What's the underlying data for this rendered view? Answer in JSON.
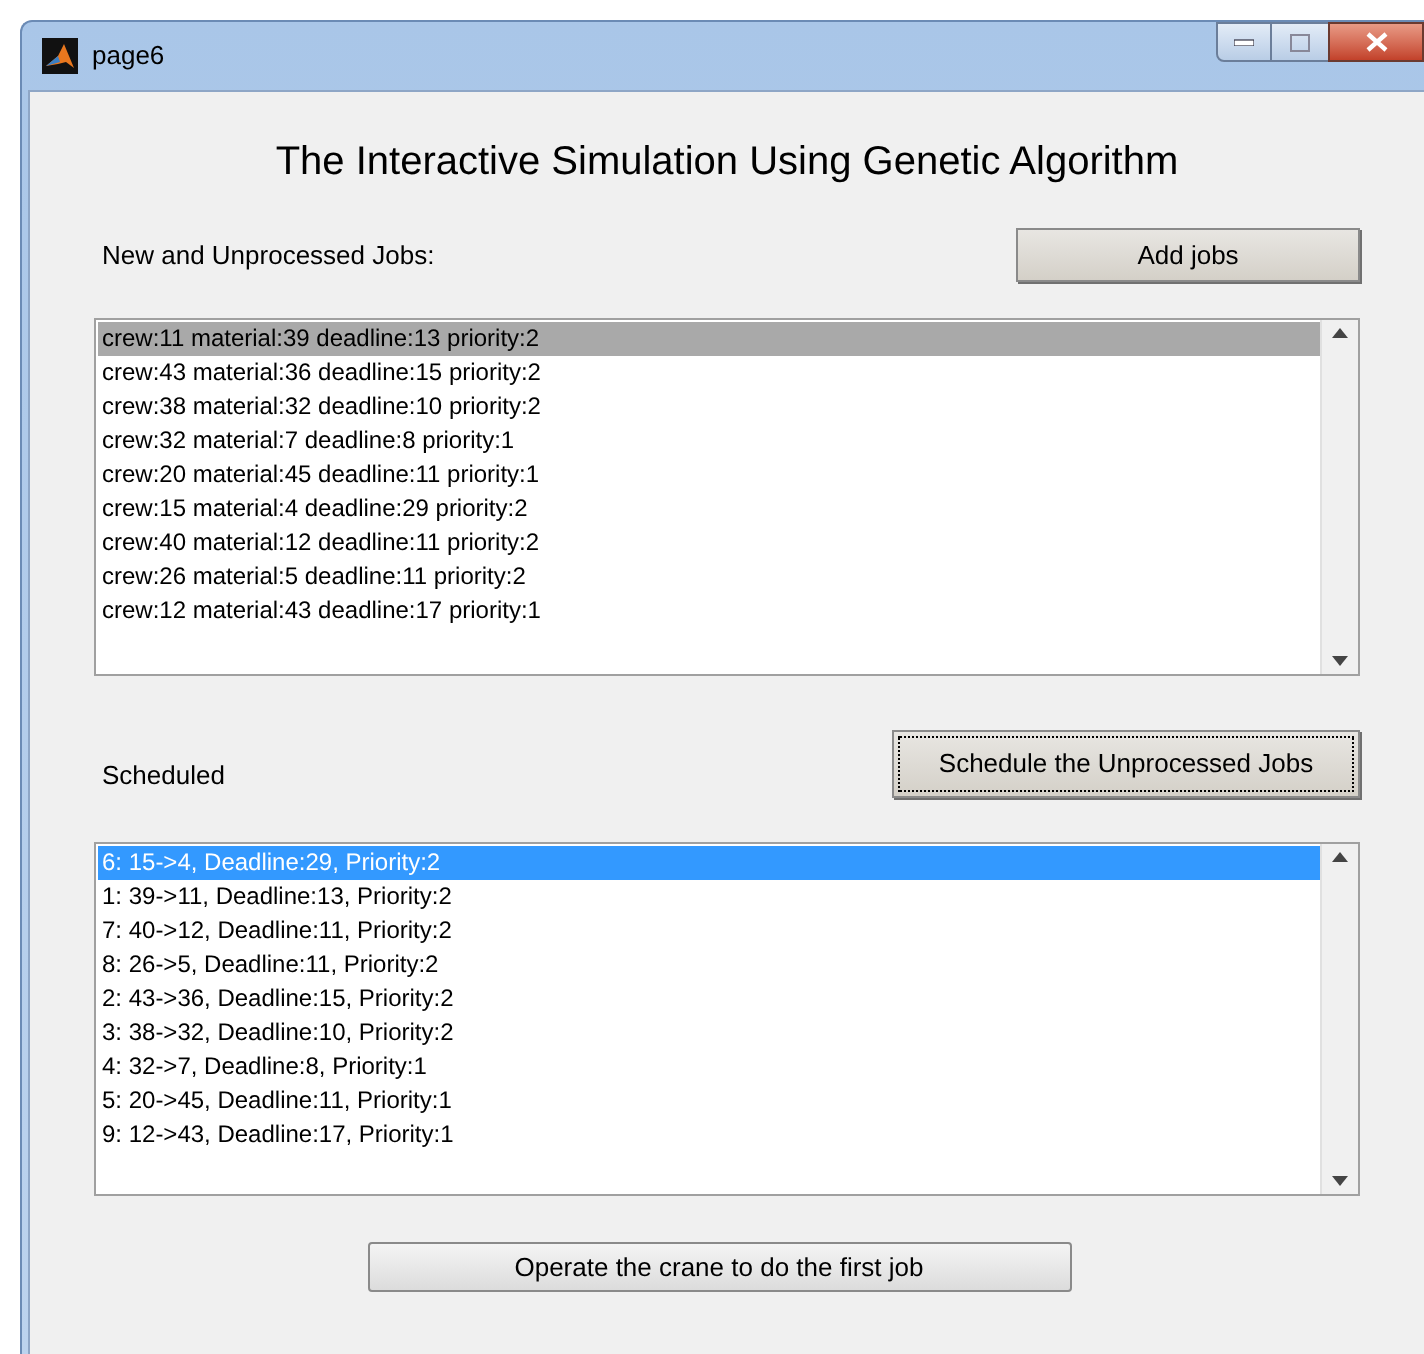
{
  "window": {
    "title": "page6"
  },
  "heading": "The Interactive Simulation Using Genetic Algorithm",
  "sections": [
    {
      "label": "New and Unprocessed Jobs:",
      "button": {
        "label": "Add jobs",
        "focused": false
      },
      "list": {
        "focused": false,
        "items": [
          {
            "text": "crew:11 material:39 deadline:13 priority:2",
            "selected": true
          },
          {
            "text": "crew:43 material:36 deadline:15 priority:2",
            "selected": false
          },
          {
            "text": "crew:38 material:32 deadline:10 priority:2",
            "selected": false
          },
          {
            "text": "crew:32 material:7 deadline:8 priority:1",
            "selected": false
          },
          {
            "text": "crew:20 material:45 deadline:11 priority:1",
            "selected": false
          },
          {
            "text": "crew:15 material:4 deadline:29 priority:2",
            "selected": false
          },
          {
            "text": "crew:40 material:12 deadline:11 priority:2",
            "selected": false
          },
          {
            "text": "crew:26 material:5 deadline:11 priority:2",
            "selected": false
          },
          {
            "text": "crew:12 material:43 deadline:17 priority:1",
            "selected": false
          }
        ]
      }
    },
    {
      "label": "Scheduled",
      "button": {
        "label": "Schedule the Unprocessed Jobs",
        "focused": true
      },
      "list": {
        "focused": true,
        "items": [
          {
            "text": "6: 15->4, Deadline:29, Priority:2",
            "selected": true
          },
          {
            "text": "1: 39->11, Deadline:13, Priority:2",
            "selected": false
          },
          {
            "text": "7: 40->12, Deadline:11, Priority:2",
            "selected": false
          },
          {
            "text": "8: 26->5, Deadline:11, Priority:2",
            "selected": false
          },
          {
            "text": "2: 43->36, Deadline:15, Priority:2",
            "selected": false
          },
          {
            "text": "3: 38->32, Deadline:10, Priority:2",
            "selected": false
          },
          {
            "text": "4: 32->7, Deadline:8, Priority:1",
            "selected": false
          },
          {
            "text": "5: 20->45, Deadline:11, Priority:1",
            "selected": false
          },
          {
            "text": "9: 12->43, Deadline:17, Priority:1",
            "selected": false
          }
        ]
      }
    }
  ],
  "action_button": "Operate the crane to do the first job"
}
